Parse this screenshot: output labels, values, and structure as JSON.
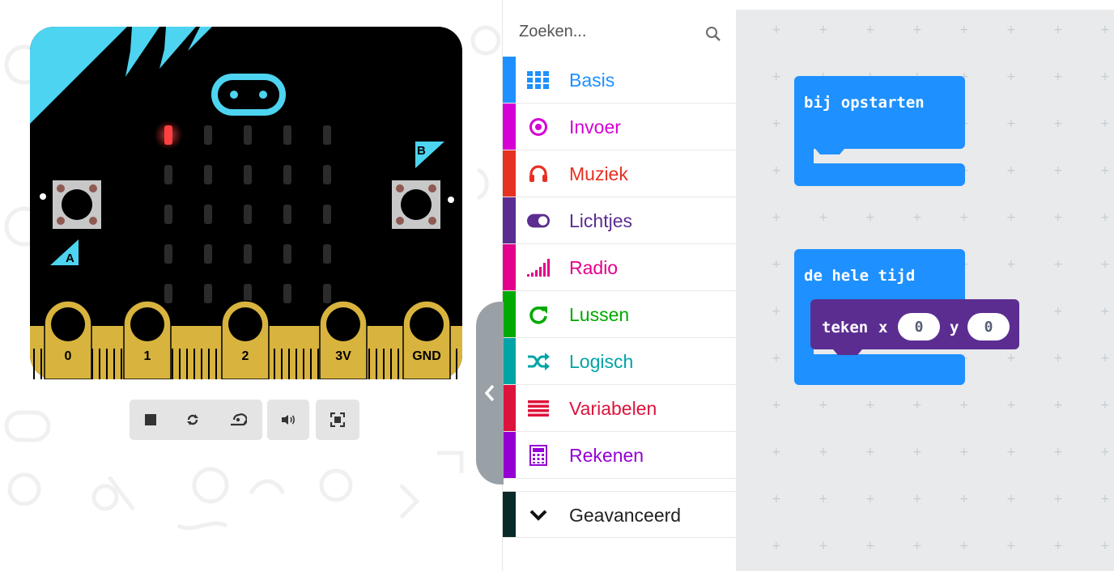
{
  "simulator": {
    "button_a_label": "A",
    "button_b_label": "B",
    "pins": [
      "0",
      "1",
      "2",
      "3V",
      "GND"
    ],
    "lit_led": {
      "row": 0,
      "col": 0
    },
    "colors": {
      "board": "#000000",
      "accent": "#4dd4f0",
      "pin_gold": "#d8b43e",
      "led_on": "#ff4040",
      "led_off": "#2b2b2b"
    },
    "toolbar": {
      "group1": [
        "stop-icon",
        "restart-icon",
        "slow-motion-icon"
      ],
      "group2": [
        "sound-icon"
      ],
      "group3": [
        "fullscreen-icon"
      ]
    }
  },
  "toolbox": {
    "search_placeholder": "Zoeken...",
    "categories": [
      {
        "label": "Basis",
        "color": "#1e90ff",
        "icon": "grid-icon"
      },
      {
        "label": "Invoer",
        "color": "#d400d4",
        "icon": "target-icon"
      },
      {
        "label": "Muziek",
        "color": "#e63022",
        "icon": "headphones-icon"
      },
      {
        "label": "Lichtjes",
        "color": "#5c2d91",
        "icon": "toggle-icon"
      },
      {
        "label": "Radio",
        "color": "#e3008c",
        "icon": "signal-icon"
      },
      {
        "label": "Lussen",
        "color": "#00aa00",
        "icon": "loop-icon"
      },
      {
        "label": "Logisch",
        "color": "#00a4a6",
        "icon": "shuffle-icon"
      },
      {
        "label": "Variabelen",
        "color": "#dc143c",
        "icon": "list-icon"
      },
      {
        "label": "Rekenen",
        "color": "#9400d3",
        "icon": "calculator-icon"
      }
    ],
    "advanced": {
      "label": "Geavanceerd",
      "color": "#0a2a2a",
      "icon": "chevron-down-icon"
    }
  },
  "workspace": {
    "on_start": {
      "label": "bij opstarten",
      "color": "#1e90ff"
    },
    "forever": {
      "label": "de hele tijd",
      "color": "#1e90ff"
    },
    "plot": {
      "label": "teken",
      "x_label": "x",
      "x_value": "0",
      "y_label": "y",
      "y_value": "0",
      "color": "#5c2d91"
    }
  }
}
